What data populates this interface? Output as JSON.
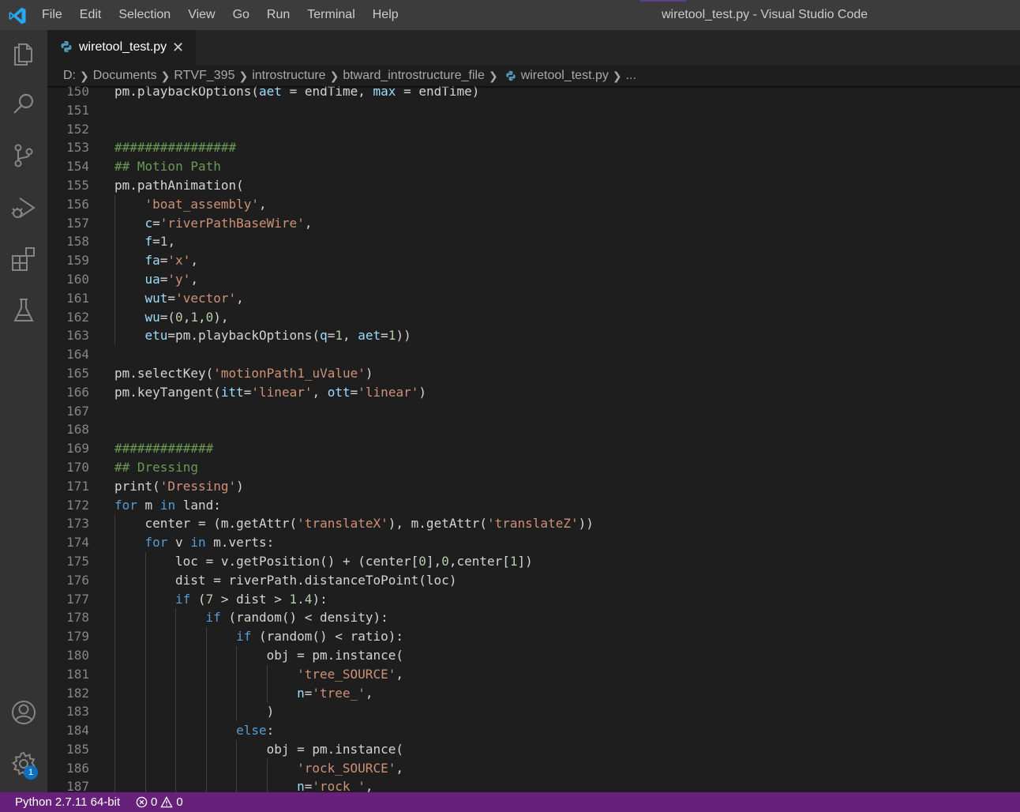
{
  "window": {
    "title": "wiretool_test.py - Visual Studio Code"
  },
  "menu": [
    "File",
    "Edit",
    "Selection",
    "View",
    "Go",
    "Run",
    "Terminal",
    "Help"
  ],
  "activity_bar": {
    "items": [
      "explorer-icon",
      "search-icon",
      "source-control-icon",
      "run-debug-icon",
      "extensions-icon",
      "testing-icon"
    ],
    "bottom": [
      "accounts-icon",
      "manage-gear-icon"
    ],
    "manage_badge": "1"
  },
  "tab": {
    "label": "wiretool_test.py",
    "close": "✕"
  },
  "breadcrumb": [
    "D:",
    "Documents",
    "RTVF_395",
    "introstructure",
    "btward_introstructure_file",
    "wiretool_test.py",
    "..."
  ],
  "colors": {
    "keyword": "#569cd6",
    "control": "#c586c0",
    "string": "#ce9178",
    "comment": "#6a9955",
    "param": "#9cdcfe",
    "number": "#b5cea8",
    "default": "#d4d4d4",
    "statusbar": "#68217a"
  },
  "code": [
    {
      "n": "150",
      "i": 0,
      "t": [
        [
          "pm.playbackOptions(",
          "d"
        ],
        [
          "aet",
          "p"
        ],
        [
          " = endTime, ",
          "d"
        ],
        [
          "max",
          "p"
        ],
        [
          " = endTime)",
          "d"
        ]
      ]
    },
    {
      "n": "151",
      "i": 0,
      "t": []
    },
    {
      "n": "152",
      "i": 0,
      "t": []
    },
    {
      "n": "153",
      "i": 0,
      "t": [
        [
          "################",
          "c"
        ]
      ]
    },
    {
      "n": "154",
      "i": 0,
      "t": [
        [
          "## Motion Path",
          "c"
        ]
      ]
    },
    {
      "n": "155",
      "i": 0,
      "t": [
        [
          "pm.pathAnimation(",
          "d"
        ]
      ]
    },
    {
      "n": "156",
      "i": 1,
      "t": [
        [
          "'boat_assembly'",
          "s"
        ],
        [
          ",",
          "d"
        ]
      ]
    },
    {
      "n": "157",
      "i": 1,
      "t": [
        [
          "c",
          "p"
        ],
        [
          "=",
          "d"
        ],
        [
          "'riverPathBaseWire'",
          "s"
        ],
        [
          ",",
          "d"
        ]
      ]
    },
    {
      "n": "158",
      "i": 1,
      "t": [
        [
          "f",
          "p"
        ],
        [
          "=",
          "d"
        ],
        [
          "1",
          "n"
        ],
        [
          ",",
          "d"
        ]
      ]
    },
    {
      "n": "159",
      "i": 1,
      "t": [
        [
          "fa",
          "p"
        ],
        [
          "=",
          "d"
        ],
        [
          "'x'",
          "s"
        ],
        [
          ",",
          "d"
        ]
      ]
    },
    {
      "n": "160",
      "i": 1,
      "t": [
        [
          "ua",
          "p"
        ],
        [
          "=",
          "d"
        ],
        [
          "'y'",
          "s"
        ],
        [
          ",",
          "d"
        ]
      ]
    },
    {
      "n": "161",
      "i": 1,
      "t": [
        [
          "wut",
          "p"
        ],
        [
          "=",
          "d"
        ],
        [
          "'vector'",
          "s"
        ],
        [
          ",",
          "d"
        ]
      ]
    },
    {
      "n": "162",
      "i": 1,
      "t": [
        [
          "wu",
          "p"
        ],
        [
          "=(",
          "d"
        ],
        [
          "0",
          "n"
        ],
        [
          ",",
          "d"
        ],
        [
          "1",
          "n"
        ],
        [
          ",",
          "d"
        ],
        [
          "0",
          "n"
        ],
        [
          "),",
          "d"
        ]
      ]
    },
    {
      "n": "163",
      "i": 1,
      "t": [
        [
          "etu",
          "p"
        ],
        [
          "=pm.playbackOptions(",
          "d"
        ],
        [
          "q",
          "p"
        ],
        [
          "=",
          "d"
        ],
        [
          "1",
          "n"
        ],
        [
          ", ",
          "d"
        ],
        [
          "aet",
          "p"
        ],
        [
          "=",
          "d"
        ],
        [
          "1",
          "n"
        ],
        [
          "))",
          "d"
        ]
      ]
    },
    {
      "n": "164",
      "i": 0,
      "t": []
    },
    {
      "n": "165",
      "i": 0,
      "t": [
        [
          "pm.selectKey(",
          "d"
        ],
        [
          "'motionPath1_uValue'",
          "s"
        ],
        [
          ")",
          "d"
        ]
      ]
    },
    {
      "n": "166",
      "i": 0,
      "t": [
        [
          "pm.keyTangent(",
          "d"
        ],
        [
          "itt",
          "p"
        ],
        [
          "=",
          "d"
        ],
        [
          "'linear'",
          "s"
        ],
        [
          ", ",
          "d"
        ],
        [
          "ott",
          "p"
        ],
        [
          "=",
          "d"
        ],
        [
          "'linear'",
          "s"
        ],
        [
          ")",
          "d"
        ]
      ]
    },
    {
      "n": "167",
      "i": 0,
      "t": []
    },
    {
      "n": "168",
      "i": 0,
      "t": []
    },
    {
      "n": "169",
      "i": 0,
      "t": [
        [
          "#############",
          "c"
        ]
      ]
    },
    {
      "n": "170",
      "i": 0,
      "t": [
        [
          "## Dressing",
          "c"
        ]
      ]
    },
    {
      "n": "171",
      "i": 0,
      "t": [
        [
          "print(",
          "d"
        ],
        [
          "'Dressing'",
          "s"
        ],
        [
          ")",
          "d"
        ]
      ]
    },
    {
      "n": "172",
      "i": 0,
      "t": [
        [
          "for",
          "k"
        ],
        [
          " m ",
          "d"
        ],
        [
          "in",
          "k"
        ],
        [
          " land:",
          "d"
        ]
      ]
    },
    {
      "n": "173",
      "i": 1,
      "t": [
        [
          "center = (m.getAttr(",
          "d"
        ],
        [
          "'translateX'",
          "s"
        ],
        [
          "), m.getAttr(",
          "d"
        ],
        [
          "'translateZ'",
          "s"
        ],
        [
          "))",
          "d"
        ]
      ]
    },
    {
      "n": "174",
      "i": 1,
      "t": [
        [
          "for",
          "k"
        ],
        [
          " v ",
          "d"
        ],
        [
          "in",
          "k"
        ],
        [
          " m.verts:",
          "d"
        ]
      ]
    },
    {
      "n": "175",
      "i": 2,
      "t": [
        [
          "loc = v.getPosition() + (center[",
          "d"
        ],
        [
          "0",
          "n"
        ],
        [
          "],",
          "d"
        ],
        [
          "0",
          "n"
        ],
        [
          ",center[",
          "d"
        ],
        [
          "1",
          "n"
        ],
        [
          "])",
          "d"
        ]
      ]
    },
    {
      "n": "176",
      "i": 2,
      "t": [
        [
          "dist = riverPath.distanceToPoint(loc)",
          "d"
        ]
      ]
    },
    {
      "n": "177",
      "i": 2,
      "t": [
        [
          "if",
          "k"
        ],
        [
          " (",
          "d"
        ],
        [
          "7",
          "n"
        ],
        [
          " > dist > ",
          "d"
        ],
        [
          "1.4",
          "n"
        ],
        [
          "):",
          "d"
        ]
      ]
    },
    {
      "n": "178",
      "i": 3,
      "t": [
        [
          "if",
          "k"
        ],
        [
          " (random() < density):",
          "d"
        ]
      ]
    },
    {
      "n": "179",
      "i": 4,
      "t": [
        [
          "if",
          "k"
        ],
        [
          " (random() < ratio):",
          "d"
        ]
      ]
    },
    {
      "n": "180",
      "i": 5,
      "t": [
        [
          "obj = pm.instance(",
          "d"
        ]
      ]
    },
    {
      "n": "181",
      "i": 6,
      "t": [
        [
          "'tree_SOURCE'",
          "s"
        ],
        [
          ",",
          "d"
        ]
      ]
    },
    {
      "n": "182",
      "i": 6,
      "t": [
        [
          "n",
          "p"
        ],
        [
          "=",
          "d"
        ],
        [
          "'tree_'",
          "s"
        ],
        [
          ",",
          "d"
        ]
      ]
    },
    {
      "n": "183",
      "i": 5,
      "t": [
        [
          ")",
          "d"
        ]
      ]
    },
    {
      "n": "184",
      "i": 4,
      "t": [
        [
          "else",
          "k"
        ],
        [
          ":",
          "d"
        ]
      ]
    },
    {
      "n": "185",
      "i": 5,
      "t": [
        [
          "obj = pm.instance(",
          "d"
        ]
      ]
    },
    {
      "n": "186",
      "i": 6,
      "t": [
        [
          "'rock_SOURCE'",
          "s"
        ],
        [
          ",",
          "d"
        ]
      ]
    },
    {
      "n": "187",
      "i": 6,
      "t": [
        [
          "n",
          "p"
        ],
        [
          "=",
          "d"
        ],
        [
          "'rock_'",
          "s"
        ],
        [
          ",",
          "d"
        ]
      ]
    }
  ],
  "status": {
    "python": "Python 2.7.11 64-bit",
    "errors": "0",
    "warnings": "0"
  }
}
